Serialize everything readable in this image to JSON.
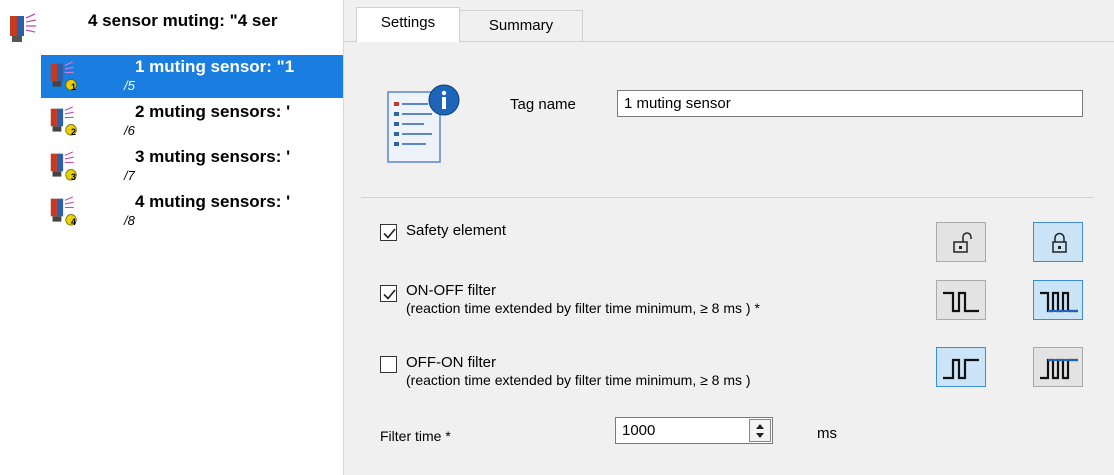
{
  "tree": {
    "root": {
      "label": "4 sensor muting: \"4 ser"
    },
    "items": [
      {
        "title": "1 muting sensor: \"1",
        "sub": "/5",
        "badge": "1",
        "selected": true
      },
      {
        "title": "2 muting sensors: '",
        "sub": "/6",
        "badge": "2",
        "selected": false
      },
      {
        "title": "3 muting sensors: '",
        "sub": "/7",
        "badge": "3",
        "selected": false
      },
      {
        "title": "4 muting sensors: '",
        "sub": "/8",
        "badge": "4",
        "selected": false
      }
    ]
  },
  "tabs": [
    {
      "label": "Settings",
      "active": true
    },
    {
      "label": "Summary",
      "active": false
    }
  ],
  "settings": {
    "tag_name_label": "Tag name",
    "tag_name_value": "1 muting sensor",
    "safety_element": {
      "label": "Safety element",
      "checked": true
    },
    "on_off_filter": {
      "label": "ON-OFF filter",
      "desc": "(reaction time extended by filter time minimum, ≥ 8 ms ) *",
      "checked": true
    },
    "off_on_filter": {
      "label": "OFF-ON filter",
      "desc": "(reaction time extended by filter time minimum, ≥ 8 ms )",
      "checked": false
    },
    "filter_time": {
      "label": "Filter time *",
      "value": "1000",
      "unit": "ms"
    }
  },
  "icons": {
    "tree_sensor": "muting-sensor-icon",
    "info": "info-document-icon",
    "unlock": "unlock-icon",
    "lock": "lock-icon",
    "on_off_a": "on-off-pulse-icon",
    "on_off_b": "on-off-pulse-filtered-icon",
    "off_on_a": "off-on-pulse-icon",
    "off_on_b": "off-on-pulse-filtered-icon"
  },
  "colors": {
    "selection": "#1a7de0",
    "panel_bg": "#f0f0f0",
    "toggle_on_bg": "#cce4f7",
    "toggle_on_border": "#3e8bd6",
    "badge": "#e8d200"
  }
}
